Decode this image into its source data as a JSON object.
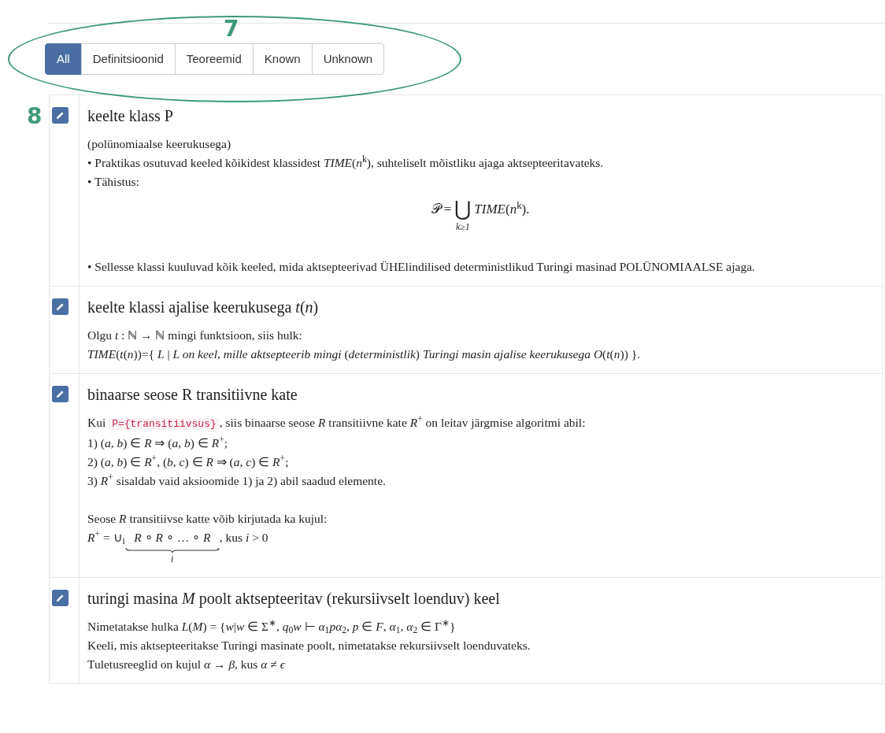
{
  "filter_tabs": [
    {
      "label": "All",
      "selected": true
    },
    {
      "label": "Definitsioonid",
      "selected": false
    },
    {
      "label": "Teoreemid",
      "selected": false
    },
    {
      "label": "Known",
      "selected": false
    },
    {
      "label": "Unknown",
      "selected": false
    }
  ],
  "annotations": [
    {
      "kind": "ellipse",
      "number": "7"
    },
    {
      "kind": "label",
      "number": "8"
    }
  ],
  "entries": [
    {
      "title": "keelte klass P",
      "lines": [
        {
          "kind": "text",
          "text": "(polünomiaalse keerukusega)"
        },
        {
          "kind": "text",
          "text": "• Praktikas osutuvad keeled kõikidest klassidest *TIME*(*n*$^{k}$), suhteliselt mõistliku ajaga aktsepteeritavateks."
        },
        {
          "kind": "text",
          "text": "• Tähistus:"
        },
        {
          "kind": "display",
          "before": "𝒫 =",
          "operator": "⋃",
          "under": "k≥1",
          "after": "*TIME*(*n*$^{k}$)."
        },
        {
          "kind": "gap"
        },
        {
          "kind": "text",
          "text": "• Sellesse klassi kuuluvad kõik keeled, mida aktsepteerivad ÜHElindilised deterministlikud Turingi masinad POLÜNOMIAALSE ajaga."
        }
      ]
    },
    {
      "title": "keelte klassi ajalise keerukusega *t*(*n*)",
      "lines": [
        {
          "kind": "text",
          "text": "Olgu *t* : ℕ → ℕ mingi funktsioon, siis hulk:"
        },
        {
          "kind": "text",
          "text": "*TIME*(*t*(*n*))={ *L* | *L on keel, mille aktsepteerib mingi* (*deterministlik*) *Turingi masin ajalise keerukusega O*(*t*(*n*)) }."
        }
      ]
    },
    {
      "title": "binaarse seose R transitiivne kate",
      "lines": [
        {
          "kind": "code_line",
          "before": "Kui",
          "code": "P={transitiivsus}",
          "after": ", siis binaarse seose *R* transitiivne kate *R*$^{+}$ on leitav järgmise algoritmi abil:"
        },
        {
          "kind": "text",
          "text": "1) (*a*, *b*) ∈ *R* ⇒ (*a*, *b*) ∈ *R*$^{+}$;"
        },
        {
          "kind": "text",
          "text": "2) (*a*, *b*) ∈ *R*$^{+}$, (*b*, *c*) ∈ *R* ⇒ (*a*, *c*) ∈ *R*$^{+}$;"
        },
        {
          "kind": "text",
          "text": "3) *R*$^{+}$ sisaldab vaid aksioomide 1) ja 2) abil saadud elemente."
        },
        {
          "kind": "gap"
        },
        {
          "kind": "text",
          "text": "Seose *R* transitiivse katte võib kirjutada ka kujul:"
        },
        {
          "kind": "underbrace",
          "before": "*R*$^{+}$ = ∪$_{i}$",
          "braced": "*R* ∘ *R* ∘ … ∘ *R*",
          "under": "i",
          "after": ", kus *i* > 0"
        }
      ]
    },
    {
      "title": "turingi masina *M* poolt aktsepteeritav (rekursiivselt loenduv) keel",
      "lines": [
        {
          "kind": "text",
          "text": "Nimetatakse hulka *L*(*M*) = {*w*|*w* ∈ Σ$^{∗}$, *q*$_{0}$*w* ⊢ *α*$_{1}$*pα*$_{2}$, *p* ∈ *F*, *α*$_{1}$, *α*$_{2}$ ∈ Γ$^{∗}$}"
        },
        {
          "kind": "text",
          "text": "Keeli, mis aktsepteeritakse Turingi masinate poolt, nimetatakse rekursiivselt loenduvateks."
        },
        {
          "kind": "text",
          "text": "Tuletusreeglid on kujul *α* → *β*, kus *α* ≠ *ϵ*"
        }
      ]
    }
  ]
}
